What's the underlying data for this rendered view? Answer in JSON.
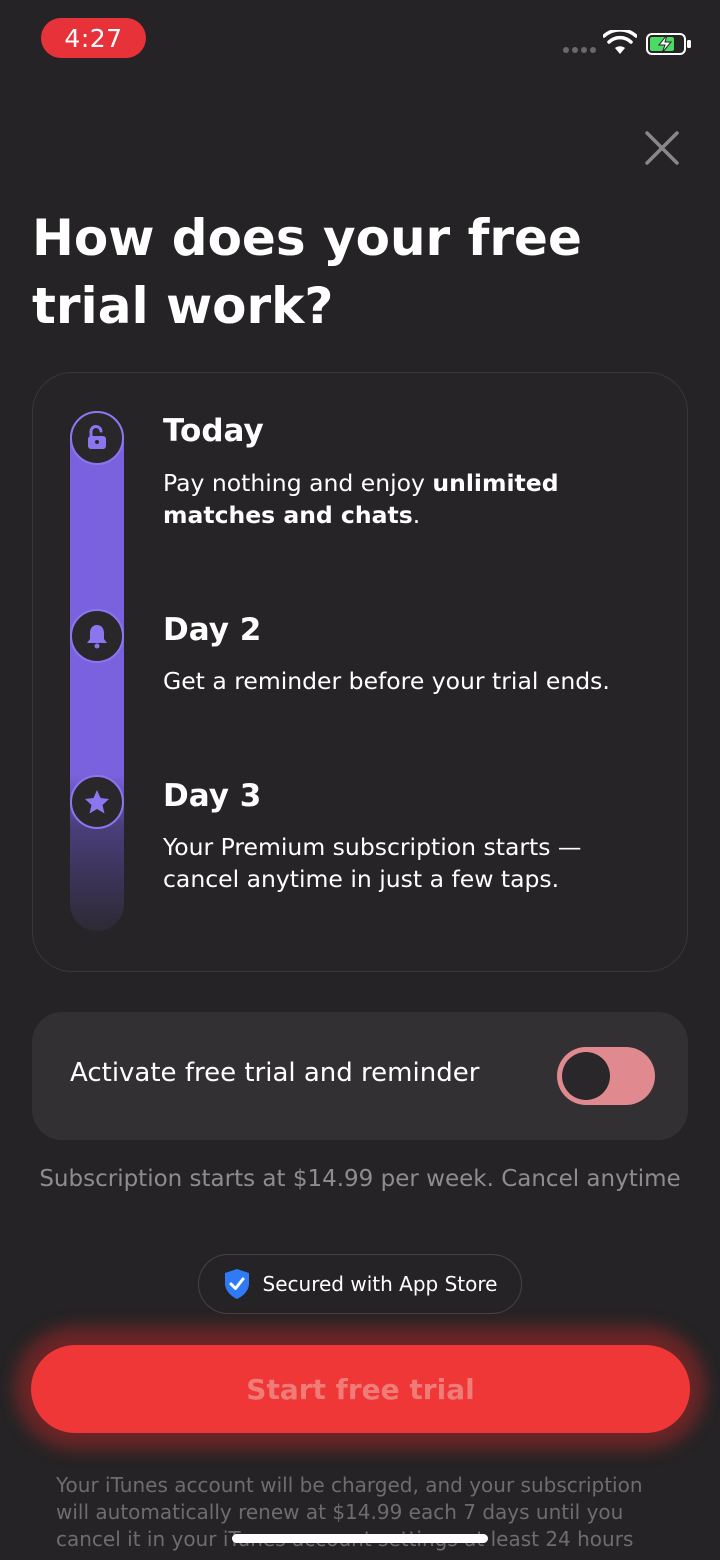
{
  "status_bar": {
    "time": "4:27"
  },
  "close_icon": "close-x-icon",
  "title": "How does your free trial work?",
  "timeline": {
    "accent_color": "#7a62de",
    "steps": [
      {
        "icon": "unlock-icon",
        "title": "Today",
        "desc_plain": "Pay nothing and enjoy ",
        "desc_bold": "unlimited matches and chats",
        "desc_end": "."
      },
      {
        "icon": "bell-icon",
        "title": "Day 2",
        "desc": "Get a reminder before your trial ends."
      },
      {
        "icon": "star-icon",
        "title": "Day 3",
        "desc": "Your Premium subscription starts — cancel anytime in just a few taps."
      }
    ]
  },
  "toggle": {
    "label": "Activate free trial and reminder",
    "state": "off",
    "color": "#e08a90"
  },
  "price_note": "Subscription starts at $14.99 per week. Cancel anytime",
  "secured": {
    "icon": "shield-check-icon",
    "label": "Secured with App Store"
  },
  "cta": {
    "label": "Start free trial",
    "color": "#ef3737"
  },
  "legal": "Your iTunes account will be charged, and your subscription will automatically renew at $14.99 each 7 days until you cancel it in your iTunes account settings at least 24 hours"
}
